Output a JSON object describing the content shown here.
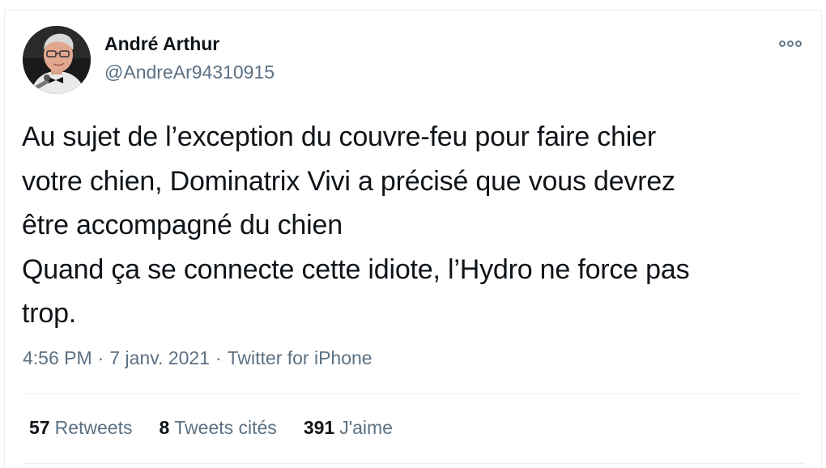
{
  "author": {
    "display_name": "André Arthur",
    "handle": "@AndreAr94310915"
  },
  "tweet": {
    "lines": [
      "Au sujet de l’exception du couvre-feu pour faire chier",
      "votre chien, Dominatrix Vivi a précisé que vous devrez",
      "être accompagné du chien",
      "Quand ça se connecte cette idiote, l’Hydro ne force pas",
      "trop."
    ],
    "time": "4:56 PM",
    "date": "7 janv. 2021",
    "source": "Twitter for iPhone",
    "separator": "·"
  },
  "stats": {
    "retweets_count": "57",
    "retweets_label": "Retweets",
    "quotes_count": "8",
    "quotes_label": "Tweets cités",
    "likes_count": "391",
    "likes_label": "J'aime"
  },
  "colors": {
    "text": "#0f1419",
    "secondary": "#5b7083",
    "border": "#ebeef0"
  },
  "icons": {
    "more": "more-horizontal-icon"
  }
}
